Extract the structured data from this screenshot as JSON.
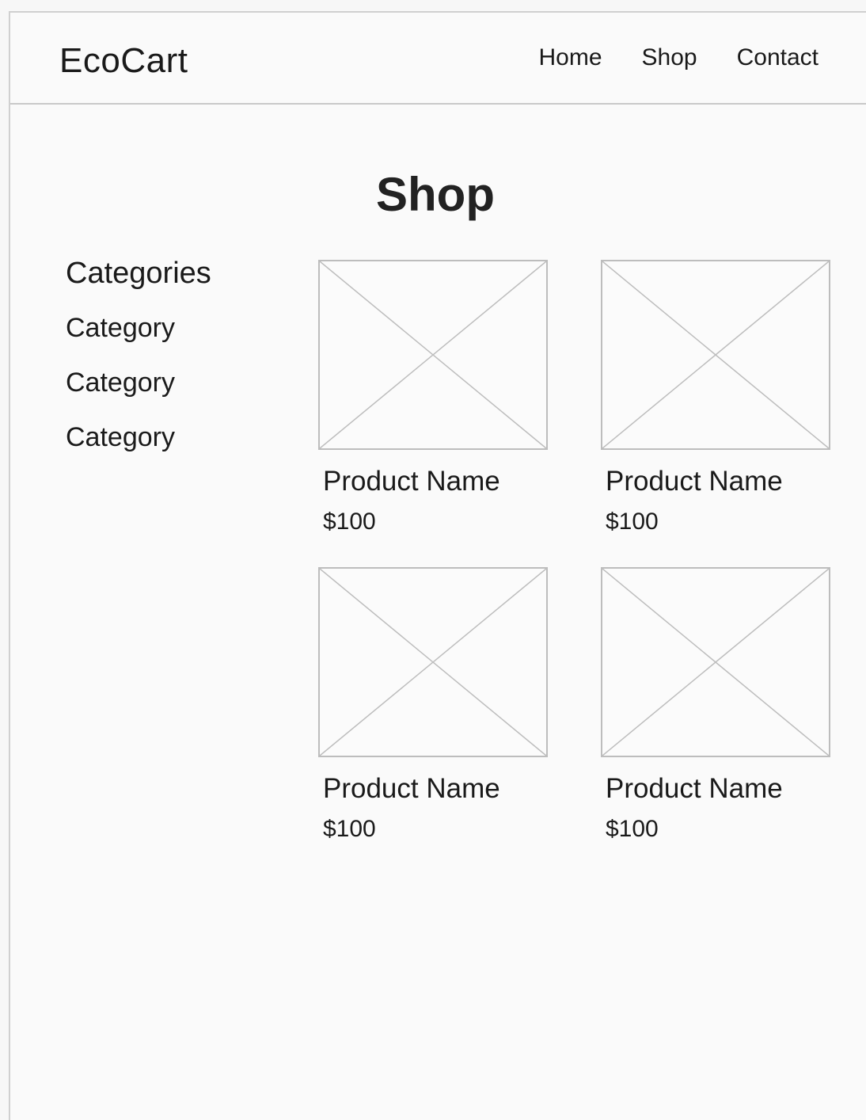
{
  "header": {
    "logo": "EcoCart",
    "nav": [
      "Home",
      "Shop",
      "Contact"
    ]
  },
  "page": {
    "title": "Shop"
  },
  "sidebar": {
    "title": "Categories",
    "items": [
      "Category",
      "Category",
      "Category"
    ]
  },
  "products": [
    {
      "name": "Product Name",
      "price": "$100",
      "image": "image-placeholder-icon"
    },
    {
      "name": "Product Name",
      "price": "$100",
      "image": "image-placeholder-icon"
    },
    {
      "name": "Product Name",
      "price": "$100",
      "image": "image-placeholder-icon"
    },
    {
      "name": "Product Name",
      "price": "$100",
      "image": "image-placeholder-icon"
    }
  ]
}
